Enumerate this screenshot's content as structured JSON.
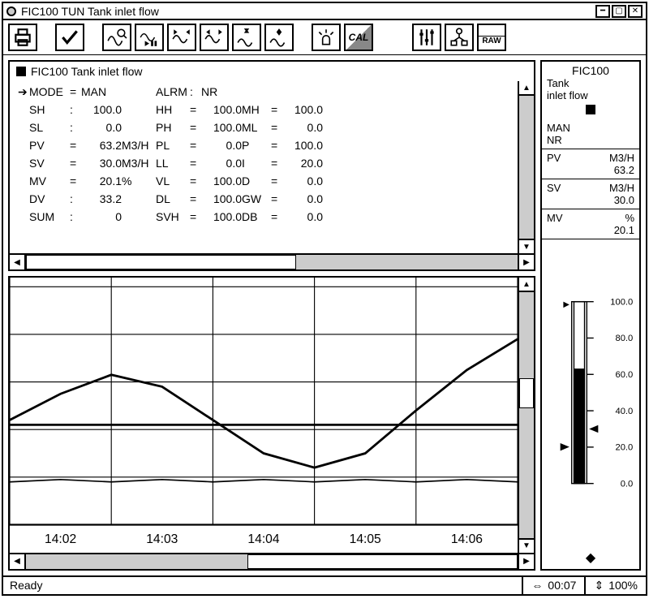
{
  "window": {
    "title": "FIC100 TUN Tank inlet flow"
  },
  "toolbar": {
    "cal_label": "CAL",
    "raw_label": "RAW"
  },
  "data_pane": {
    "title": "FIC100 Tank inlet flow",
    "mode_label": "MODE",
    "mode_value": "MAN",
    "alrm_label": "ALRM",
    "alrm_value": "NR",
    "rows": [
      {
        "l": "SH",
        "s": ":",
        "v": "100.0",
        "u": "",
        "c2": "HH",
        "e2": "=",
        "v2": "100.0",
        "c3": "MH",
        "e3": "=",
        "v3": "100.0"
      },
      {
        "l": "SL",
        "s": ":",
        "v": "0.0",
        "u": "",
        "c2": "PH",
        "e2": "=",
        "v2": "100.0",
        "c3": "ML",
        "e3": "=",
        "v3": "0.0"
      },
      {
        "l": "PV",
        "s": "=",
        "v": "63.2",
        "u": "M3/H",
        "c2": "PL",
        "e2": "=",
        "v2": "0.0",
        "c3": "P",
        "e3": "=",
        "v3": "100.0"
      },
      {
        "l": "SV",
        "s": "=",
        "v": "30.0",
        "u": "M3/H",
        "c2": "LL",
        "e2": "=",
        "v2": "0.0",
        "c3": "I",
        "e3": "=",
        "v3": "20.0"
      },
      {
        "l": "MV",
        "s": "=",
        "v": "20.1",
        "u": "%",
        "c2": "VL",
        "e2": "=",
        "v2": "100.0",
        "c3": "D",
        "e3": "=",
        "v3": "0.0"
      },
      {
        "l": "DV",
        "s": ":",
        "v": "33.2",
        "u": "",
        "c2": "DL",
        "e2": "=",
        "v2": "100.0",
        "c3": "GW",
        "e3": "=",
        "v3": "0.0"
      },
      {
        "l": "SUM",
        "s": ":",
        "v": "0",
        "u": "",
        "c2": "SVH",
        "e2": "=",
        "v2": "100.0",
        "c3": "DB",
        "e3": "=",
        "v3": "0.0"
      }
    ]
  },
  "right_panel": {
    "tag": "FIC100",
    "desc1": "Tank",
    "desc2": "inlet flow",
    "mode": "MAN",
    "alarm": "NR",
    "pv_label": "PV",
    "pv_unit": "M3/H",
    "pv_value": "63.2",
    "sv_label": "SV",
    "sv_unit": "M3/H",
    "sv_value": "30.0",
    "mv_label": "MV",
    "mv_unit": "%",
    "mv_value": "20.1",
    "scale": {
      "t100": "100.0",
      "t80": "80.0",
      "t60": "60.0",
      "t40": "40.0",
      "t20": "20.0",
      "t0": "0.0"
    }
  },
  "status": {
    "ready": "Ready",
    "time": "00:07",
    "zoom": "100%"
  },
  "chart_data": {
    "type": "line",
    "xlabel": "",
    "ylabel": "",
    "ylim": [
      0,
      100
    ],
    "x_ticks": [
      "14:02",
      "14:03",
      "14:04",
      "14:05",
      "14:06"
    ],
    "series": [
      {
        "name": "PV",
        "values": [
          44,
          55,
          63,
          58,
          44,
          30,
          24,
          30,
          48,
          65,
          78
        ],
        "x": [
          0,
          0.5,
          1,
          1.5,
          2,
          2.5,
          3,
          3.5,
          4,
          4.5,
          5
        ]
      },
      {
        "name": "SV",
        "values": [
          42,
          42,
          42,
          42,
          42,
          42,
          42,
          42,
          42,
          42,
          42
        ],
        "x": [
          0,
          0.5,
          1,
          1.5,
          2,
          2.5,
          3,
          3.5,
          4,
          4.5,
          5
        ]
      },
      {
        "name": "MV",
        "values": [
          18,
          19,
          18,
          19,
          18,
          19,
          18,
          19,
          18,
          19,
          18
        ],
        "x": [
          0,
          0.5,
          1,
          1.5,
          2,
          2.5,
          3,
          3.5,
          4,
          4.5,
          5
        ]
      }
    ]
  }
}
